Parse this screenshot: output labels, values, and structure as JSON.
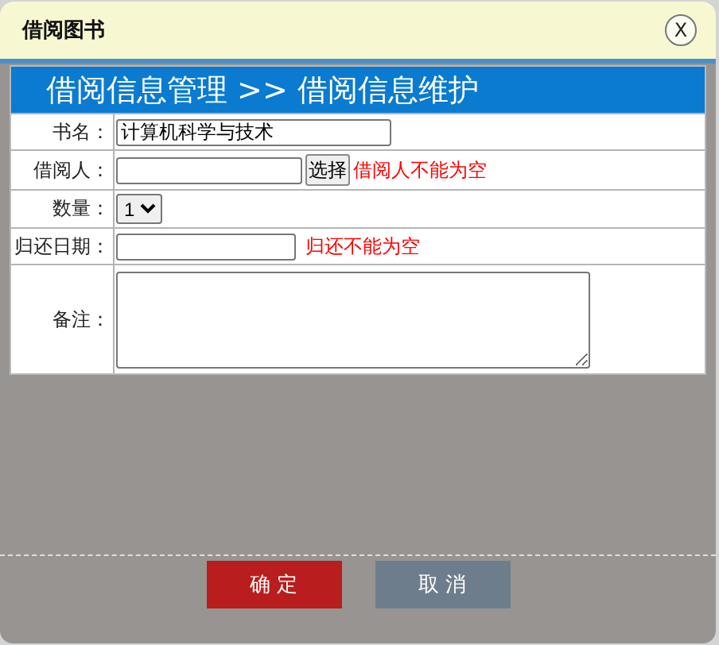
{
  "dialog": {
    "title": "借阅图书",
    "close": "X"
  },
  "header": "借阅信息管理 >> 借阅信息维护",
  "rows": [
    {
      "label": "书名：",
      "kind": "text",
      "value": "计算机科学与技术"
    },
    {
      "label": "借阅人：",
      "kind": "picker",
      "button": "选择",
      "error": "借阅人不能为空"
    },
    {
      "label": "数量：",
      "kind": "select",
      "value": "1"
    },
    {
      "label": "归还日期：",
      "kind": "date",
      "error": "归还不能为空"
    },
    {
      "label": "备注：",
      "kind": "textarea"
    }
  ],
  "buttons": [
    {
      "label": "确 定",
      "kind": "primary"
    },
    {
      "label": "取 消",
      "kind": "secondary"
    }
  ]
}
